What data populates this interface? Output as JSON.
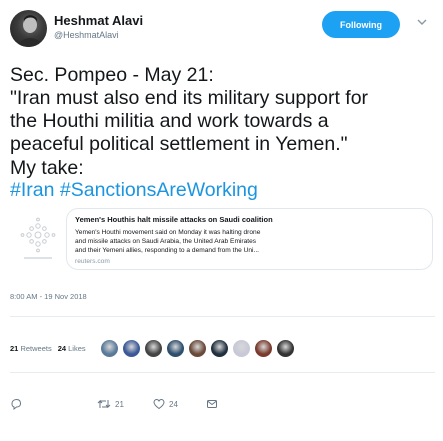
{
  "author": {
    "name": "Heshmat Alavi",
    "handle": "@HeshmatAlavi",
    "follow_label": "Following"
  },
  "tweet": {
    "lines": [
      "Sec. Pompeo - May 21:",
      "\"Iran must also end its military support for",
      "the Houthi militia and work towards a",
      "peaceful political settlement in Yemen.\""
    ],
    "take_line": "My take:",
    "hashtags": [
      "#Iran",
      "#SanctionsAreWorking"
    ]
  },
  "card": {
    "title": "Yemen's Houthis halt missile attacks on Saudi coalition",
    "description_lines": [
      "Yemen's Houthi movement said on Monday it was halting drone",
      "and missile attacks on Saudi Arabia, the United Arab Emirates",
      "and their Yemeni allies, responding to a demand from the Uni..."
    ],
    "domain": "reuters.com",
    "thumb_icon": "reuters-logo-icon"
  },
  "timestamp": "8:00 AM - 19 Nov 2018",
  "stats": {
    "retweets_count": "21",
    "retweets_label": "Retweets",
    "likes_count": "24",
    "likes_label": "Likes",
    "liker_colors": [
      "#5a7a9a",
      "#3b5998",
      "#444444",
      "#2f4f6f",
      "#6a4a3a",
      "#22313f",
      "#c8c8d8",
      "#7a3b2e",
      "#333333"
    ]
  },
  "actions": {
    "reply_icon": "reply-icon",
    "retweet_count": "21",
    "like_count": "24",
    "message_icon": "message-icon"
  },
  "colors": {
    "accent": "#1da1f2",
    "link": "#1b95e0",
    "muted": "#657786"
  }
}
